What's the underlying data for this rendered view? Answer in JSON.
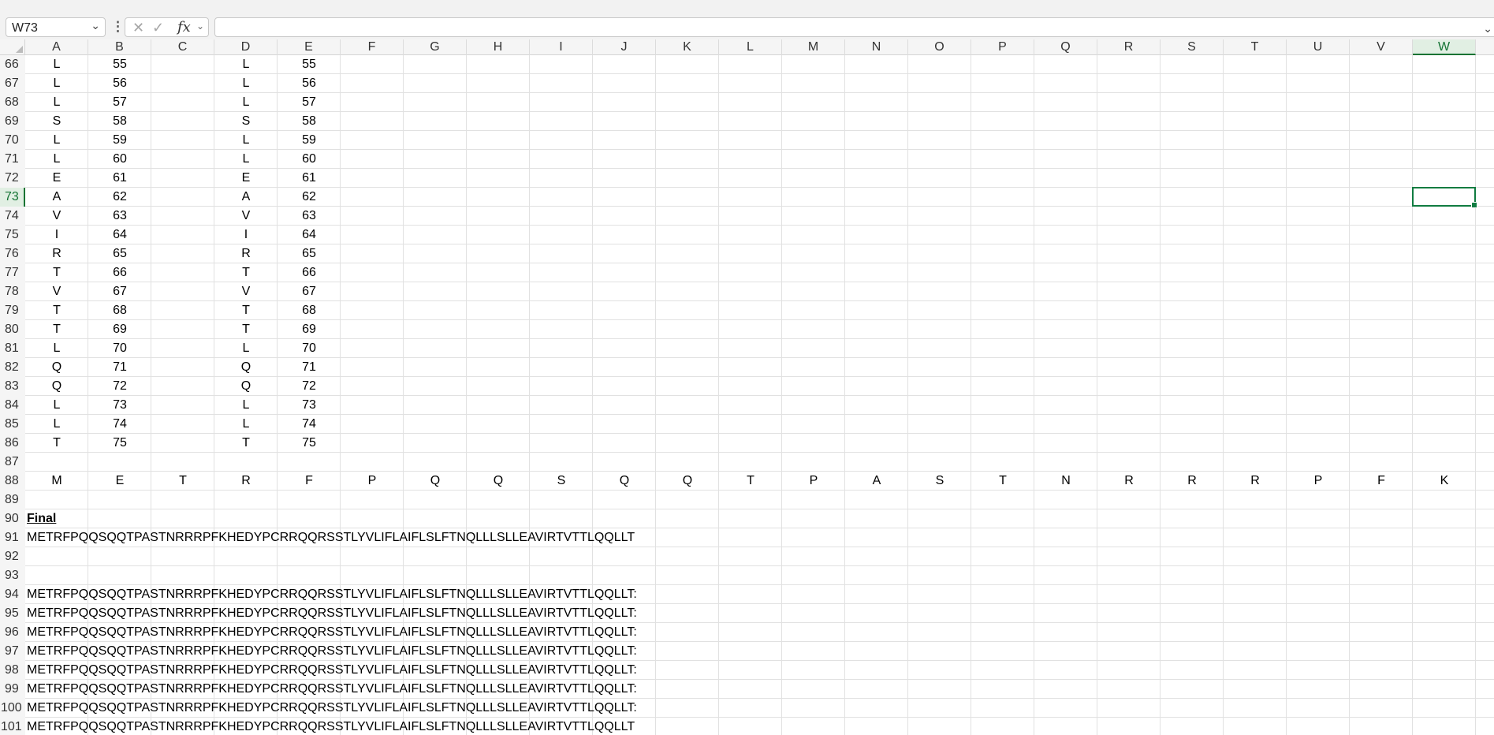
{
  "formula_bar": {
    "name_box": "W73",
    "more_icon": "vertical-ellipsis-icon",
    "cancel_icon": "cancel-x-icon",
    "enter_icon": "checkmark-icon",
    "function_icon": "fx-icon",
    "formula_value": ""
  },
  "columns": [
    "A",
    "B",
    "C",
    "D",
    "E",
    "F",
    "G",
    "H",
    "I",
    "J",
    "K",
    "L",
    "M",
    "N",
    "O",
    "P",
    "Q",
    "R",
    "S",
    "T",
    "U",
    "V",
    "W"
  ],
  "selected_cell": {
    "column": "W",
    "row": "73"
  },
  "rows": [
    {
      "num": "66",
      "cells": {
        "A": "L",
        "B": "55",
        "D": "L",
        "E": "55"
      }
    },
    {
      "num": "67",
      "cells": {
        "A": "L",
        "B": "56",
        "D": "L",
        "E": "56"
      }
    },
    {
      "num": "68",
      "cells": {
        "A": "L",
        "B": "57",
        "D": "L",
        "E": "57"
      }
    },
    {
      "num": "69",
      "cells": {
        "A": "S",
        "B": "58",
        "D": "S",
        "E": "58"
      }
    },
    {
      "num": "70",
      "cells": {
        "A": "L",
        "B": "59",
        "D": "L",
        "E": "59"
      }
    },
    {
      "num": "71",
      "cells": {
        "A": "L",
        "B": "60",
        "D": "L",
        "E": "60"
      }
    },
    {
      "num": "72",
      "cells": {
        "A": "E",
        "B": "61",
        "D": "E",
        "E": "61"
      }
    },
    {
      "num": "73",
      "cells": {
        "A": "A",
        "B": "62",
        "D": "A",
        "E": "62"
      }
    },
    {
      "num": "74",
      "cells": {
        "A": "V",
        "B": "63",
        "D": "V",
        "E": "63"
      }
    },
    {
      "num": "75",
      "cells": {
        "A": "I",
        "B": "64",
        "D": "I",
        "E": "64"
      }
    },
    {
      "num": "76",
      "cells": {
        "A": "R",
        "B": "65",
        "D": "R",
        "E": "65"
      }
    },
    {
      "num": "77",
      "cells": {
        "A": "T",
        "B": "66",
        "D": "T",
        "E": "66"
      }
    },
    {
      "num": "78",
      "cells": {
        "A": "V",
        "B": "67",
        "D": "V",
        "E": "67"
      }
    },
    {
      "num": "79",
      "cells": {
        "A": "T",
        "B": "68",
        "D": "T",
        "E": "68"
      }
    },
    {
      "num": "80",
      "cells": {
        "A": "T",
        "B": "69",
        "D": "T",
        "E": "69"
      }
    },
    {
      "num": "81",
      "cells": {
        "A": "L",
        "B": "70",
        "D": "L",
        "E": "70"
      }
    },
    {
      "num": "82",
      "cells": {
        "A": "Q",
        "B": "71",
        "D": "Q",
        "E": "71"
      }
    },
    {
      "num": "83",
      "cells": {
        "A": "Q",
        "B": "72",
        "D": "Q",
        "E": "72"
      }
    },
    {
      "num": "84",
      "cells": {
        "A": "L",
        "B": "73",
        "D": "L",
        "E": "73"
      }
    },
    {
      "num": "85",
      "cells": {
        "A": "L",
        "B": "74",
        "D": "L",
        "E": "74"
      }
    },
    {
      "num": "86",
      "cells": {
        "A": "T",
        "B": "75",
        "D": "T",
        "E": "75"
      }
    },
    {
      "num": "87",
      "cells": {}
    },
    {
      "num": "88",
      "cells": {
        "A": "M",
        "B": "E",
        "C": "T",
        "D": "R",
        "E": "F",
        "F": "P",
        "G": "Q",
        "H": "Q",
        "I": "S",
        "J": "Q",
        "K": "Q",
        "L": "T",
        "M": "P",
        "N": "A",
        "O": "S",
        "P": "T",
        "Q": "N",
        "R": "R",
        "S": "R",
        "T": "R",
        "U": "P",
        "V": "F",
        "W": "K"
      }
    },
    {
      "num": "89",
      "cells": {}
    },
    {
      "num": "90",
      "cells": {
        "A": "Final"
      },
      "style": "final"
    },
    {
      "num": "91",
      "cells": {
        "A": "METRFPQQSQQTPASTNRRRPFKHEDYPCRRQQRSSTLYVLIFLAIFLSLFTNQLLLSLLEAVIRTVTTLQQLLT"
      },
      "style": "text"
    },
    {
      "num": "92",
      "cells": {}
    },
    {
      "num": "93",
      "cells": {}
    },
    {
      "num": "94",
      "cells": {
        "A": "METRFPQQSQQTPASTNRRRPFKHEDYPCRRQQRSSTLYVLIFLAIFLSLFTNQLLLSLLEAVIRTVTTLQQLLT:"
      },
      "style": "text"
    },
    {
      "num": "95",
      "cells": {
        "A": "METRFPQQSQQTPASTNRRRPFKHEDYPCRRQQRSSTLYVLIFLAIFLSLFTNQLLLSLLEAVIRTVTTLQQLLT:"
      },
      "style": "text"
    },
    {
      "num": "96",
      "cells": {
        "A": "METRFPQQSQQTPASTNRRRPFKHEDYPCRRQQRSSTLYVLIFLAIFLSLFTNQLLLSLLEAVIRTVTTLQQLLT:"
      },
      "style": "text"
    },
    {
      "num": "97",
      "cells": {
        "A": "METRFPQQSQQTPASTNRRRPFKHEDYPCRRQQRSSTLYVLIFLAIFLSLFTNQLLLSLLEAVIRTVTTLQQLLT:"
      },
      "style": "text"
    },
    {
      "num": "98",
      "cells": {
        "A": "METRFPQQSQQTPASTNRRRPFKHEDYPCRRQQRSSTLYVLIFLAIFLSLFTNQLLLSLLEAVIRTVTTLQQLLT:"
      },
      "style": "text"
    },
    {
      "num": "99",
      "cells": {
        "A": "METRFPQQSQQTPASTNRRRPFKHEDYPCRRQQRSSTLYVLIFLAIFLSLFTNQLLLSLLEAVIRTVTTLQQLLT:"
      },
      "style": "text"
    },
    {
      "num": "100",
      "cells": {
        "A": "METRFPQQSQQTPASTNRRRPFKHEDYPCRRQQRSSTLYVLIFLAIFLSLFTNQLLLSLLEAVIRTVTTLQQLLT:"
      },
      "style": "text"
    },
    {
      "num": "101",
      "cells": {
        "A": "METRFPQQSQQTPASTNRRRPFKHEDYPCRRQQRSSTLYVLIFLAIFLSLFTNQLLLSLLEAVIRTVTTLQQLLT"
      },
      "style": "text"
    }
  ]
}
